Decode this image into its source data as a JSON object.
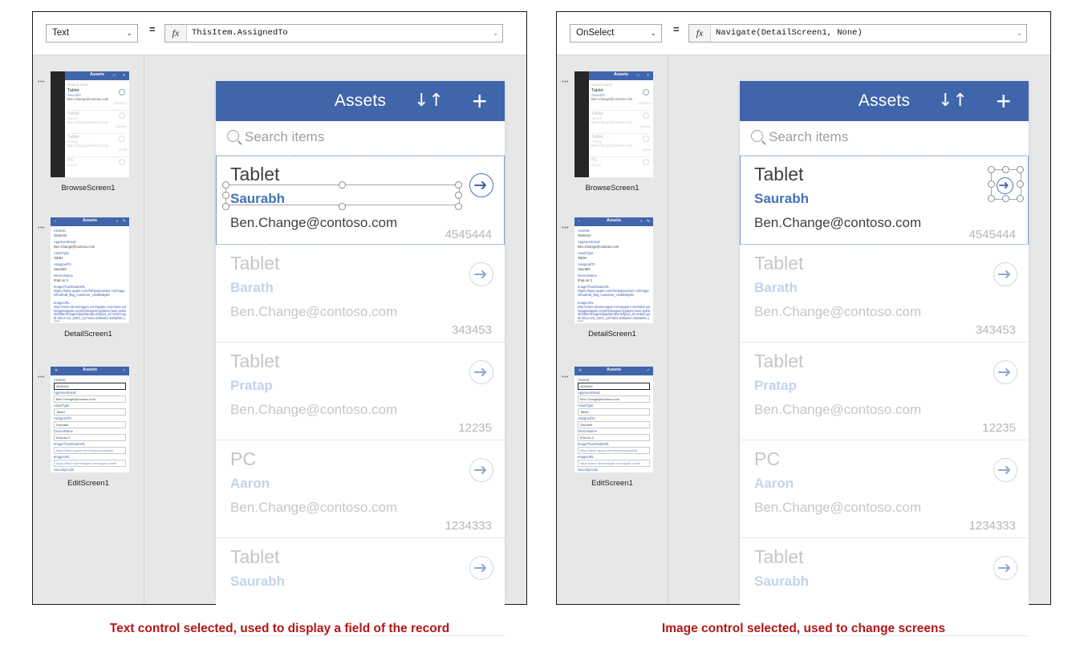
{
  "panels": [
    {
      "id": "left",
      "formula_bar": {
        "property": "Text",
        "equals": "=",
        "fx_glyph": "fx",
        "formula": "ThisItem.AssignedTo",
        "chevron": "⌄"
      },
      "caption": "Text control selected, used to display a field of the record",
      "screens": [
        {
          "label": "BrowseScreen1",
          "dots": "•••"
        },
        {
          "label": "DetailScreen1",
          "dots": "•••"
        },
        {
          "label": "EditScreen1",
          "dots": "•••"
        }
      ],
      "app": {
        "header": {
          "title": "Assets",
          "sort_icon": "↓↑",
          "add_icon": "+"
        },
        "search": {
          "placeholder": "Search items",
          "icon": "search-icon"
        },
        "gallery": [
          {
            "title": "Tablet",
            "assigned": "Saurabh",
            "email": "Ben.Change@contoso.com",
            "number": "4545444"
          },
          {
            "title": "Tablet",
            "assigned": "Barath",
            "email": "Ben.Change@contoso.com",
            "number": "343453"
          },
          {
            "title": "Tablet",
            "assigned": "Pratap",
            "email": "Ben.Change@contoso.com",
            "number": "12235"
          },
          {
            "title": "PC",
            "assigned": "Aaron",
            "email": "Ben.Change@contoso.com",
            "number": "1234333"
          },
          {
            "title": "Tablet",
            "assigned": "Saurabh",
            "email": "",
            "number": ""
          }
        ]
      },
      "selection": "text-control"
    },
    {
      "id": "right",
      "formula_bar": {
        "property": "OnSelect",
        "equals": "=",
        "fx_glyph": "fx",
        "formula": "Navigate(DetailScreen1, None)",
        "chevron": "⌄"
      },
      "caption": "Image control selected, used to change screens",
      "screens": [
        {
          "label": "BrowseScreen1",
          "dots": "•••"
        },
        {
          "label": "DetailScreen1",
          "dots": "•••"
        },
        {
          "label": "EditScreen1",
          "dots": "•••"
        }
      ],
      "app": {
        "header": {
          "title": "Assets",
          "sort_icon": "↓↑",
          "add_icon": "+"
        },
        "search": {
          "placeholder": "Search items",
          "icon": "search-icon"
        },
        "gallery": [
          {
            "title": "Tablet",
            "assigned": "Saurabh",
            "email": "Ben.Change@contoso.com",
            "number": "4545444"
          },
          {
            "title": "Tablet",
            "assigned": "Barath",
            "email": "Ben.Change@contoso.com",
            "number": "343453"
          },
          {
            "title": "Tablet",
            "assigned": "Pratap",
            "email": "Ben.Change@contoso.com",
            "number": "12235"
          },
          {
            "title": "PC",
            "assigned": "Aaron",
            "email": "Ben.Change@contoso.com",
            "number": "1234333"
          },
          {
            "title": "Tablet",
            "assigned": "Saurabh",
            "email": "",
            "number": ""
          }
        ]
      },
      "selection": "image-control"
    }
  ],
  "thumbnail_content": {
    "browse": {
      "title": "Assets",
      "search": "Search items",
      "rows": [
        {
          "title": "Tablet",
          "sub": "Saurabh",
          "mail": "Ben.Change@contoso.com",
          "num": "4545444"
        },
        {
          "title": "Tablet",
          "sub": "Barath",
          "mail": "Ben.Change@contoso.com",
          "num": "343453"
        },
        {
          "title": "Tablet",
          "sub": "Pratap",
          "mail": "Ben.Change@contoso.com",
          "num": "12235"
        },
        {
          "title": "PC",
          "sub": "Aaron",
          "mail": "Ben.Change@contoso.com",
          "num": "1234333"
        },
        {
          "title": "Tablet",
          "sub": "",
          "mail": "",
          "num": ""
        }
      ]
    },
    "detail": {
      "title": "Assets",
      "fields": [
        {
          "label": "AssetID",
          "value": "4545444"
        },
        {
          "label": "ApproverEmail",
          "value": "Ben.Change@contoso.com"
        },
        {
          "label": "AssetType",
          "value": "Tablet"
        },
        {
          "label": "AssignedTo",
          "value": "Saurabh"
        },
        {
          "label": "DeviceName",
          "value": "iPad Air 2"
        },
        {
          "label": "ImageThumbnailURL",
          "value": "https://store.apple.com/for/ipa/product-cn/images/footfold_flag_customer_US8938y80"
        },
        {
          "label": "ImageURL",
          "value": "http://store.storeimages.com/apple.com/store.us/images/apple.com/ht/images/Appleinc/own-publishfolder/images/ipad/products/ipad_air-select-gold-2014-US_GEO_US?wid=436&hei=536&fmt=jpeg"
        }
      ]
    },
    "edit": {
      "title": "Assets",
      "fields": [
        {
          "label": "AssetID",
          "value": "4545444"
        },
        {
          "label": "ApproverEmail",
          "value": "Ben.Change@contoso.com"
        },
        {
          "label": "AssetType",
          "value": "Tablet"
        },
        {
          "label": "AssignedTo",
          "value": "Saurabh"
        },
        {
          "label": "DeviceName",
          "value": "iPad Air 2"
        },
        {
          "label": "ImageThumbnailURL",
          "value": "https://store.apple.com/for/ip/products/bl"
        },
        {
          "label": "ImageURL",
          "value": "https://store.storeimages.com/apple.com/fi"
        },
        {
          "label": "SecurityCode",
          "value": ""
        }
      ]
    }
  },
  "colors": {
    "brand_blue": "#4165ab",
    "accent_link": "#4472b8",
    "caption_red": "#b41616",
    "canvas_gray": "#e7e7e7",
    "dim_gray": "#c6c6c6"
  }
}
